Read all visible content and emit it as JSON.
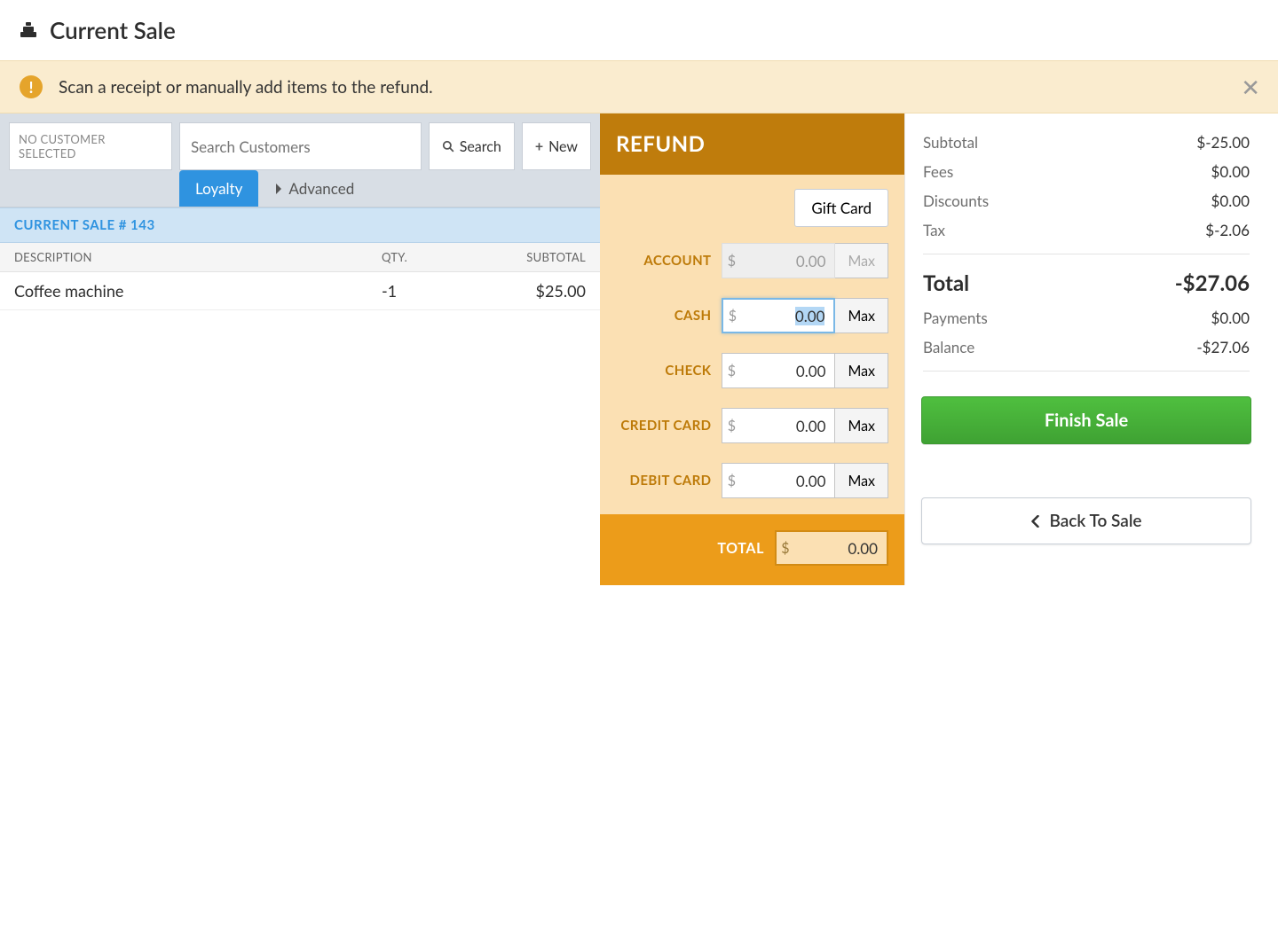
{
  "header": {
    "title": "Current Sale"
  },
  "banner": {
    "message": "Scan a receipt or manually add items to the refund."
  },
  "customer": {
    "no_customer_label": "NO CUSTOMER SELECTED",
    "search_placeholder": "Search Customers",
    "search_button": "Search",
    "new_button": "New",
    "tabs": {
      "loyalty": "Loyalty",
      "advanced": "Advanced"
    }
  },
  "sale": {
    "heading": "CURRENT SALE # 143",
    "columns": {
      "description": "DESCRIPTION",
      "qty": "QTY.",
      "subtotal": "SUBTOTAL"
    },
    "rows": [
      {
        "description": "Coffee machine",
        "qty": "-1",
        "subtotal": "$25.00"
      }
    ]
  },
  "refund": {
    "title": "REFUND",
    "giftcard_label": "Gift Card",
    "rows": {
      "account": {
        "label": "ACCOUNT",
        "value": "0.00",
        "max": "Max",
        "disabled": true
      },
      "cash": {
        "label": "CASH",
        "value": "0.00",
        "max": "Max",
        "focused": true
      },
      "check": {
        "label": "CHECK",
        "value": "0.00",
        "max": "Max"
      },
      "credit": {
        "label": "CREDIT CARD",
        "value": "0.00",
        "max": "Max"
      },
      "debit": {
        "label": "DEBIT CARD",
        "value": "0.00",
        "max": "Max"
      }
    },
    "total": {
      "label": "TOTAL",
      "value": "0.00"
    },
    "currency_symbol": "$"
  },
  "totals": {
    "subtotal": {
      "label": "Subtotal",
      "value": "$-25.00"
    },
    "fees": {
      "label": "Fees",
      "value": "$0.00"
    },
    "discounts": {
      "label": "Discounts",
      "value": "$0.00"
    },
    "tax": {
      "label": "Tax",
      "value": "$-2.06"
    },
    "total": {
      "label": "Total",
      "value": "-$27.06"
    },
    "payments": {
      "label": "Payments",
      "value": "$0.00"
    },
    "balance": {
      "label": "Balance",
      "value": "-$27.06"
    }
  },
  "actions": {
    "finish": "Finish Sale",
    "back": "Back To Sale"
  }
}
